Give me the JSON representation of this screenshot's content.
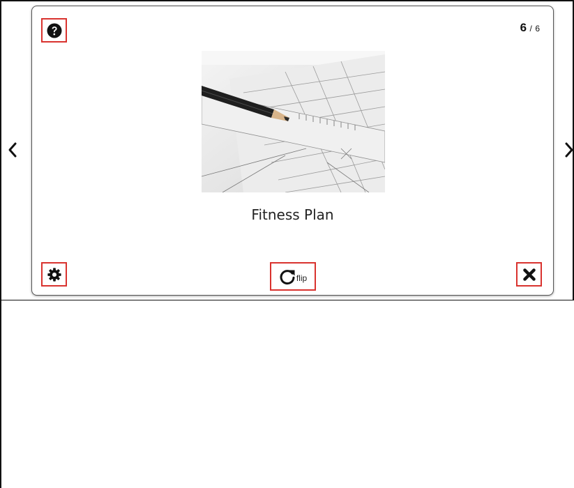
{
  "card": {
    "counter_current": "6",
    "counter_separator": "/",
    "counter_total": "6",
    "title": "Fitness Plan",
    "image_icon": "pencil-on-ruler-drawing-image"
  },
  "controls": {
    "flip_label": "flip",
    "help_icon": "question-circle-icon",
    "settings_icon": "gear-icon",
    "close_icon": "close-x-icon",
    "flip_icon": "rotate-icon",
    "prev_icon": "chevron-left-icon",
    "next_icon": "chevron-right-icon"
  },
  "colors": {
    "highlight_border": "#d9322e",
    "card_border": "#555555",
    "icon": "#111111"
  }
}
